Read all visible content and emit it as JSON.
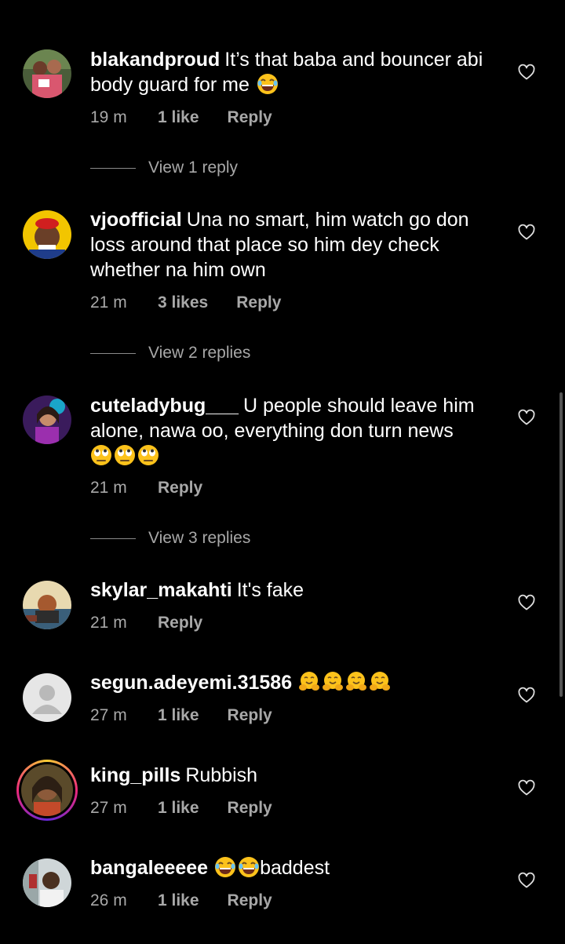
{
  "comments": [
    {
      "username": "blakandproud",
      "text": "It’s that baba and bouncer abi body guard for me",
      "time": "19 m",
      "likes": "1 like",
      "reply": "Reply",
      "view_replies": "View 1 reply",
      "emoji": "laugh"
    },
    {
      "username": "vjoofficial",
      "text": "Una no smart, him watch go don loss around that place so him dey check whether na him own",
      "time": "21 m",
      "likes": "3 likes",
      "reply": "Reply",
      "view_replies": "View 2 replies"
    },
    {
      "username": "cuteladybug___",
      "text": "U people should leave him alone, nawa oo, everything don turn news",
      "time": "21 m",
      "likes": "",
      "reply": "Reply",
      "view_replies": "View 3 replies",
      "emoji": "eyeroll"
    },
    {
      "username": "skylar_makahti",
      "text": "It's fake",
      "time": "21 m",
      "likes": "",
      "reply": "Reply"
    },
    {
      "username": "segun.adeyemi.31586",
      "text": "",
      "time": "27 m",
      "likes": "1 like",
      "reply": "Reply",
      "emoji": "hug"
    },
    {
      "username": "king_pills",
      "text": "Rubbish",
      "time": "27 m",
      "likes": "1 like",
      "reply": "Reply"
    },
    {
      "username": "bangaleeeee",
      "text": "baddest",
      "time": "26 m",
      "likes": "1 like",
      "reply": "Reply",
      "emoji": "laugh"
    }
  ],
  "colors": {
    "background": "#000000",
    "secondary_text": "#a8a8a8"
  },
  "icons": [
    "heart-icon",
    "laugh-emoji",
    "eyeroll-emoji",
    "hug-emoji",
    "default-avatar-icon"
  ]
}
